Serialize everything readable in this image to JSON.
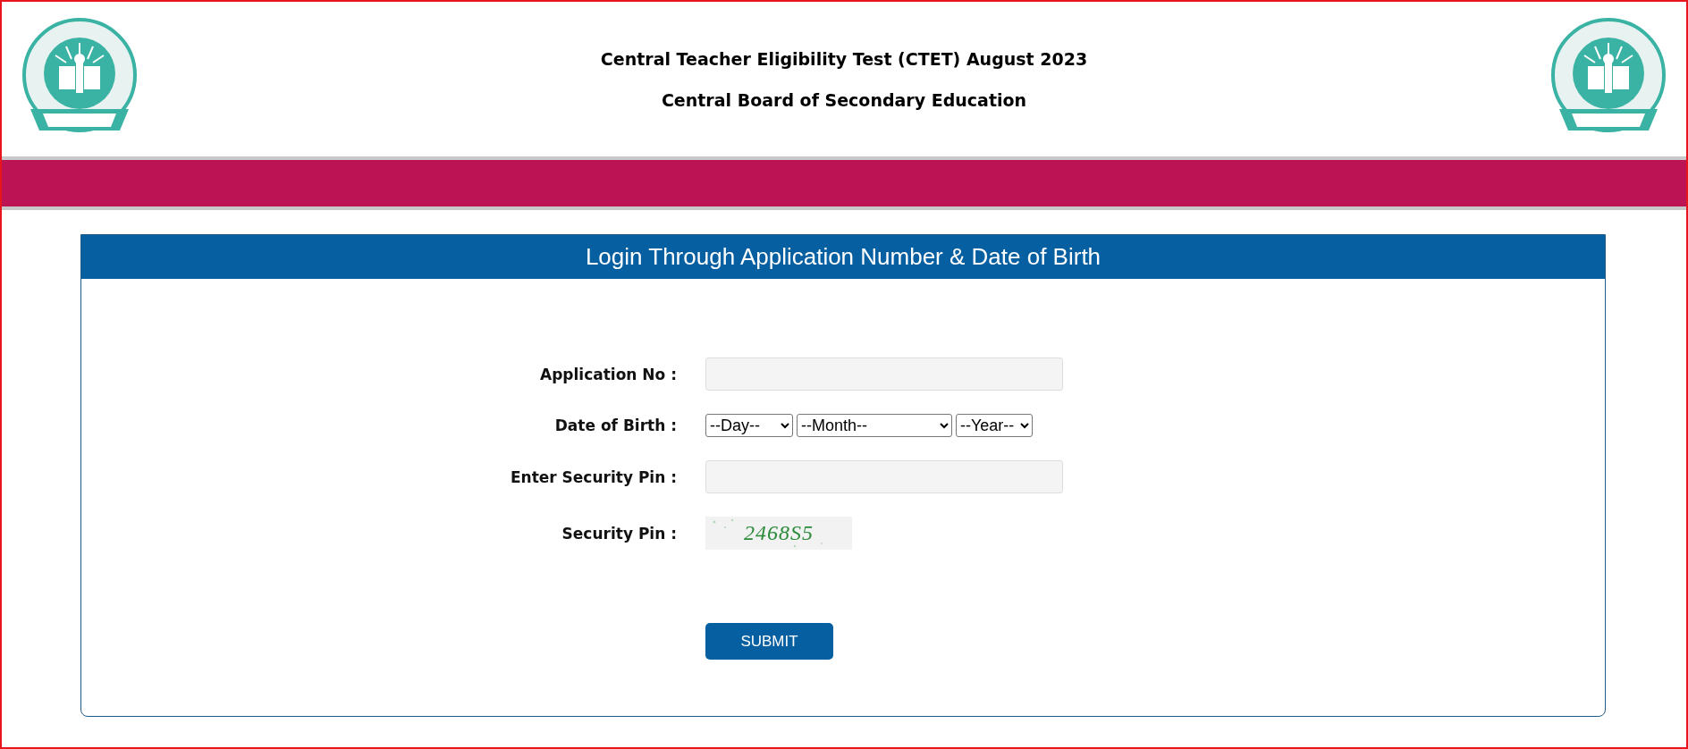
{
  "header": {
    "title": "Central Teacher Eligibility Test (CTET) August 2023",
    "subtitle": "Central Board of Secondary Education"
  },
  "login": {
    "heading": "Login Through Application Number & Date of Birth",
    "fields": [
      {
        "kind": "text",
        "label": "Application No :"
      },
      {
        "kind": "date",
        "label": "Date of Birth :",
        "selects": [
          "--Day--",
          "--Month--",
          "--Year--"
        ]
      },
      {
        "kind": "text",
        "label": "Enter Security Pin :"
      },
      {
        "kind": "captcha",
        "label": "Security Pin :",
        "code": "2468S5"
      }
    ],
    "submit": "SUBMIT"
  }
}
